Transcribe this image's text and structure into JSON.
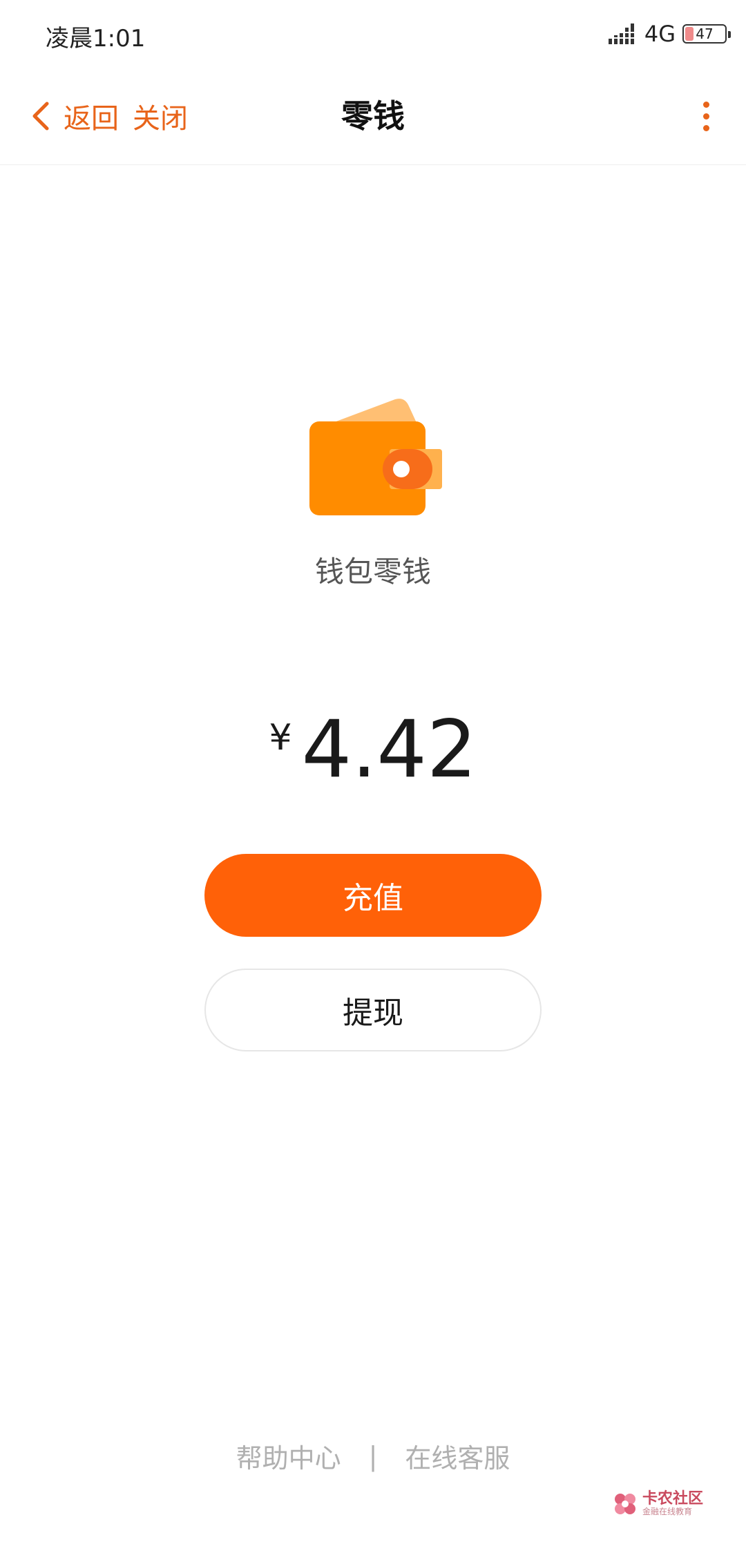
{
  "status_bar": {
    "time": "凌晨1:01",
    "network": "4G",
    "battery": "47"
  },
  "nav": {
    "back_label": "返回",
    "close_label": "关闭",
    "title": "零钱",
    "accent_color": "#e8641a"
  },
  "wallet": {
    "label": "钱包零钱",
    "currency_symbol": "¥",
    "amount": "4.42"
  },
  "actions": {
    "recharge_label": "充值",
    "recharge_color": "#ff6108",
    "withdraw_label": "提现"
  },
  "footer": {
    "help_label": "帮助中心",
    "separator": "|",
    "service_label": "在线客服"
  },
  "watermark": {
    "main": "卡农社区",
    "sub": "金融在线教育"
  }
}
